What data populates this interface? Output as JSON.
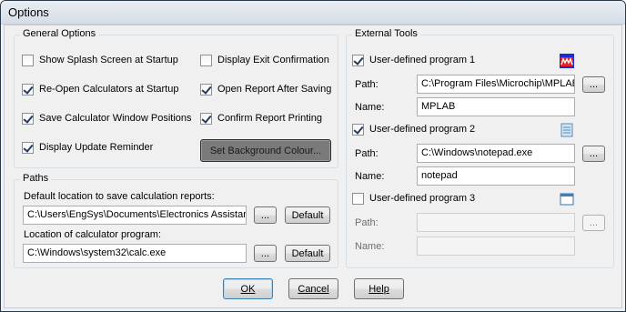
{
  "window": {
    "title": "Options"
  },
  "general_options": {
    "title": "General Options",
    "left_options": [
      {
        "label": "Show Splash Screen at Startup",
        "checked": false
      },
      {
        "label": "Re-Open Calculators at Startup",
        "checked": true
      },
      {
        "label": "Save Calculator Window Positions",
        "checked": true
      },
      {
        "label": "Display Update Reminder",
        "checked": true
      }
    ],
    "right_options": [
      {
        "label": "Display Exit Confirmation",
        "checked": false
      },
      {
        "label": "Open Report After Saving",
        "checked": true
      },
      {
        "label": "Confirm Report Printing",
        "checked": true
      }
    ],
    "background_button": "Set Background Colour..."
  },
  "paths": {
    "title": "Paths",
    "report_label": "Default location to save calculation reports:",
    "report_value": "C:\\Users\\EngSys\\Documents\\Electronics Assistan",
    "calc_label": "Location of calculator program:",
    "calc_value": "C:\\Windows\\system32\\calc.exe",
    "browse_label": "...",
    "default_label": "Default"
  },
  "external_tools": {
    "title": "External Tools",
    "path_label": "Path:",
    "name_label": "Name:",
    "browse_label": "...",
    "programs": [
      {
        "label": "User-defined program 1",
        "checked": true,
        "path": "C:\\Program Files\\Microchip\\MPLAB",
        "name": "MPLAB",
        "icon": "mplab-icon"
      },
      {
        "label": "User-defined program 2",
        "checked": true,
        "path": "C:\\Windows\\notepad.exe",
        "name": "notepad",
        "icon": "notepad-icon"
      },
      {
        "label": "User-defined program 3",
        "checked": false,
        "path": "",
        "name": "",
        "icon": "window-icon"
      }
    ]
  },
  "buttons": {
    "ok": "OK",
    "cancel": "Cancel",
    "help": "Help"
  }
}
